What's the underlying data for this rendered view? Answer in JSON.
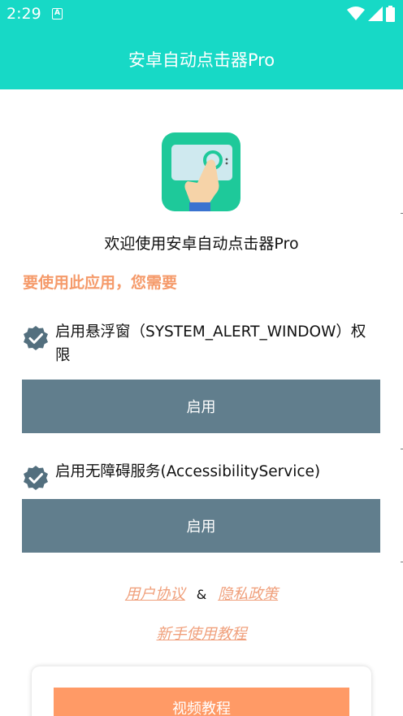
{
  "status_bar": {
    "time": "2:29",
    "notification_icon": "A"
  },
  "header": {
    "title": "安卓自动点击器Pro"
  },
  "welcome": "欢迎使用安卓自动点击器Pro",
  "need_label": "要使用此应用，您需要",
  "permissions": [
    {
      "text": "启用悬浮窗（SYSTEM_ALERT_WINDOW）权限",
      "button_label": "启用"
    },
    {
      "text": "启用无障碍服务(AccessibilityService)",
      "button_label": "启用"
    }
  ],
  "links": {
    "user_agreement": "用户协议",
    "ampersand": "&",
    "privacy_policy": "隐私政策",
    "beginner_tutorial": "新手使用教程"
  },
  "video_button_label": "视频教程",
  "colors": {
    "header": "#17d9c6",
    "accent_orange": "#f59a6a",
    "button_gray": "#617e8d",
    "video_button": "#ff9a66"
  }
}
